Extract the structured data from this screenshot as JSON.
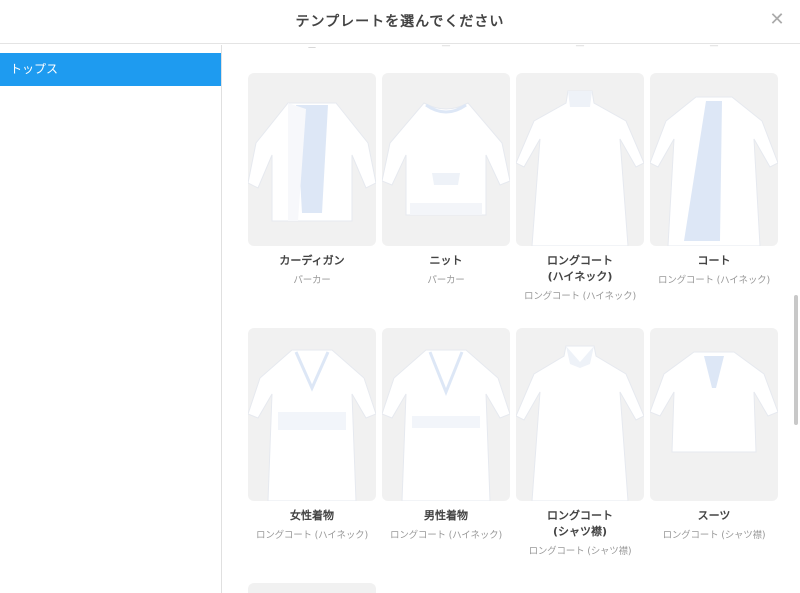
{
  "header": {
    "title": "テンプレートを選んでください",
    "close": "✕"
  },
  "sidebar": {
    "items": [
      {
        "label": "トップス"
      }
    ]
  },
  "top_cut_labels": [
    "ー",
    "—",
    "—",
    "—"
  ],
  "cards": [
    {
      "title": "カーディガン",
      "subtitle": "パーカー",
      "icon": "cardigan-icon"
    },
    {
      "title": "ニット",
      "subtitle": "パーカー",
      "icon": "knit-sweater-icon"
    },
    {
      "title": "ロングコート\n(ハイネック)",
      "subtitle": "ロングコート (ハイネック)",
      "icon": "long-coat-highneck-icon"
    },
    {
      "title": "コート",
      "subtitle": "ロングコート (ハイネック)",
      "icon": "coat-icon"
    },
    {
      "title": "女性着物",
      "subtitle": "ロングコート (ハイネック)",
      "icon": "womens-kimono-icon"
    },
    {
      "title": "男性着物",
      "subtitle": "ロングコート (ハイネック)",
      "icon": "mens-kimono-icon"
    },
    {
      "title": "ロングコート\n(シャツ襟)",
      "subtitle": "ロングコート (シャツ襟)",
      "icon": "long-coat-shirt-collar-icon"
    },
    {
      "title": "スーツ",
      "subtitle": "ロングコート (シャツ襟)",
      "icon": "suit-icon"
    }
  ],
  "colors": {
    "accent": "#1e9bf0",
    "garment": "#ffffff",
    "garment_shade": "#dde7f6",
    "thumb_bg": "#f1f1f1"
  }
}
